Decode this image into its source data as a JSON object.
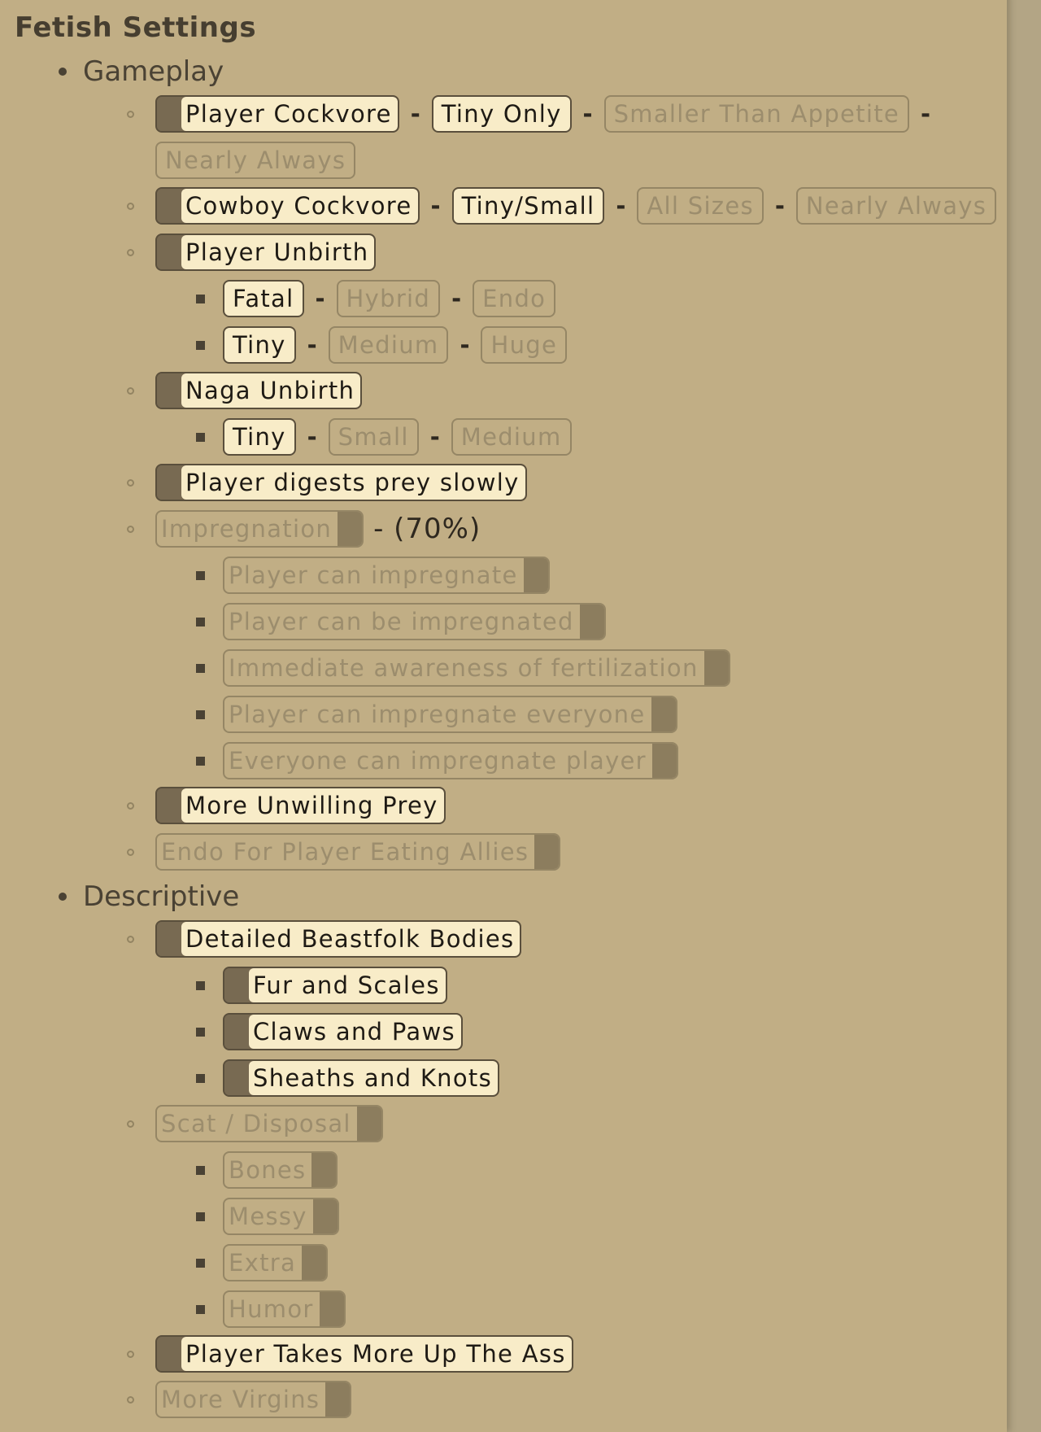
{
  "title": "Fetish Settings",
  "sections": {
    "gameplay": "Gameplay",
    "descriptive": "Descriptive"
  },
  "sep": "-",
  "items": {
    "player_cockvore": "Player Cockvore",
    "tiny_only": "Tiny Only",
    "smaller_than_appetite": "Smaller Than Appetite",
    "nearly_always_1": "Nearly Always",
    "cowboy_cockvore": "Cowboy Cockvore",
    "tiny_small": "Tiny/Small",
    "all_sizes": "All Sizes",
    "nearly_always_2": "Nearly Always",
    "player_unbirth": "Player Unbirth",
    "fatal": "Fatal",
    "hybrid": "Hybrid",
    "endo": "Endo",
    "tiny_1": "Tiny",
    "medium_1": "Medium",
    "huge": "Huge",
    "naga_unbirth": "Naga Unbirth",
    "tiny_2": "Tiny",
    "small": "Small",
    "medium_2": "Medium",
    "player_digests_slowly": "Player digests prey slowly",
    "impregnation": "Impregnation",
    "impregnation_pct": "- (70%)",
    "player_can_impregnate": "Player can impregnate",
    "player_can_be_impregnated": "Player can be impregnated",
    "immediate_awareness": "Immediate awareness of fertilization",
    "player_impregnate_everyone": "Player can impregnate everyone",
    "everyone_impregnate_player": "Everyone can impregnate player",
    "more_unwilling_prey": "More Unwilling Prey",
    "endo_player_eating_allies": "Endo For Player Eating Allies",
    "detailed_beastfolk": "Detailed Beastfolk Bodies",
    "fur_and_scales": "Fur and Scales",
    "claws_and_paws": "Claws and Paws",
    "sheaths_and_knots": "Sheaths and Knots",
    "scat_disposal": "Scat / Disposal",
    "bones": "Bones",
    "messy": "Messy",
    "extra": "Extra",
    "humor": "Humor",
    "player_takes_more": "Player Takes More Up The Ass",
    "more_virgins": "More Virgins"
  }
}
